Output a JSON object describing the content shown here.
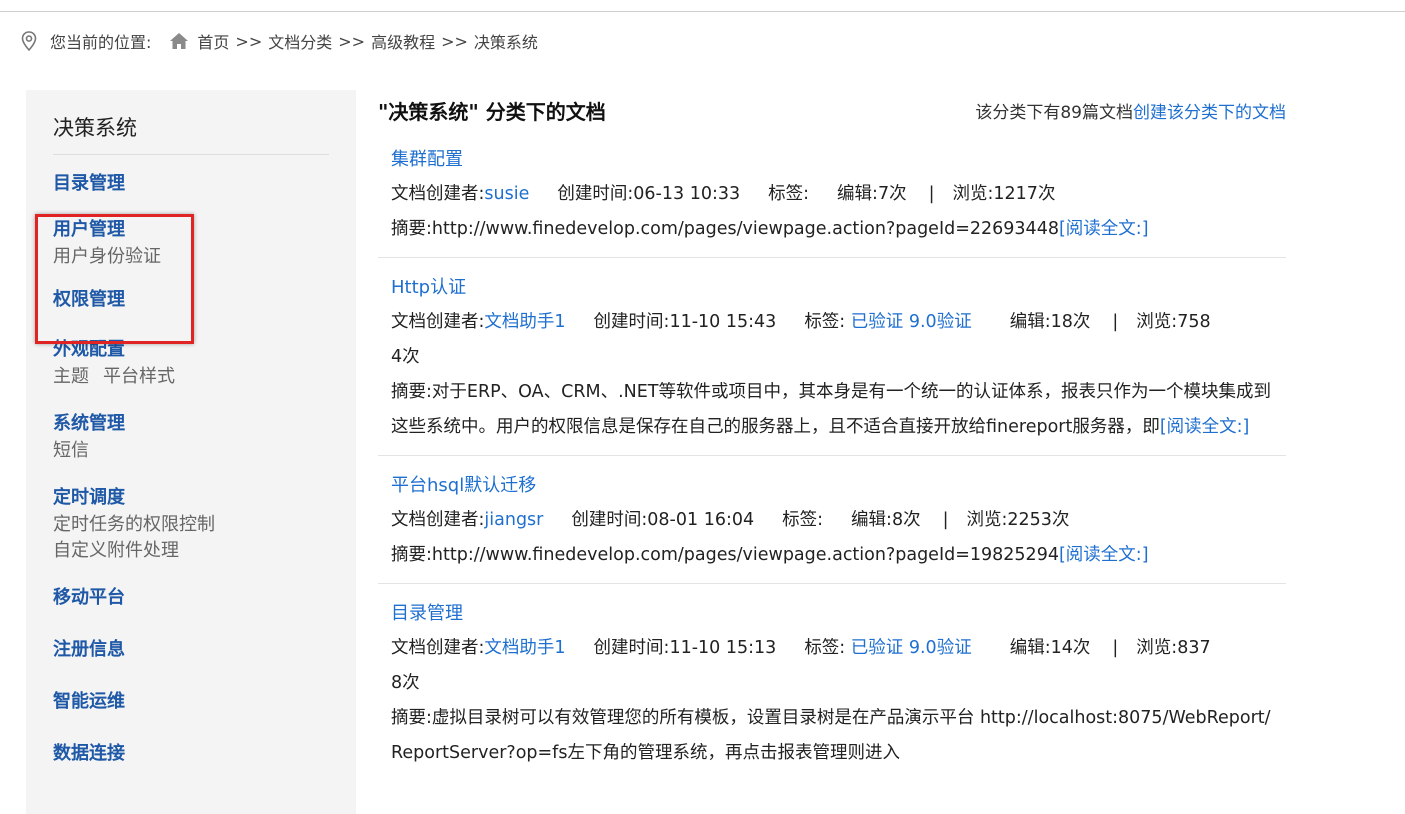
{
  "breadcrumb": {
    "prefix": "您当前的位置:",
    "home": "首页",
    "sep": ">>",
    "items": [
      "文档分类",
      "高级教程",
      "决策系统"
    ]
  },
  "sidebar": {
    "title": "决策系统",
    "groups": [
      {
        "head": "目录管理",
        "subs": []
      },
      {
        "head": "用户管理",
        "subs": [
          "用户身份验证"
        ]
      },
      {
        "head": "权限管理",
        "subs": []
      },
      {
        "head": "外观配置",
        "subs": [
          "主题",
          "平台样式"
        ]
      },
      {
        "head": "系统管理",
        "subs": [
          "短信"
        ]
      },
      {
        "head": "定时调度",
        "subs": [
          "定时任务的权限控制",
          "自定义附件处理"
        ]
      },
      {
        "head": "移动平台",
        "subs": []
      },
      {
        "head": "注册信息",
        "subs": []
      },
      {
        "head": "智能运维",
        "subs": []
      },
      {
        "head": "数据连接",
        "subs": []
      }
    ]
  },
  "main": {
    "title": "\"决策系统\" 分类下的文档",
    "count_text": "该分类下有89篇文档",
    "create_link": "创建该分类下的文档",
    "labels": {
      "creator": "文档创建者:",
      "created": "创建时间:",
      "tags": "标签:",
      "edit": "编辑:",
      "divider": "|",
      "view": "浏览:",
      "summary": "摘要:",
      "read_more": "[阅读全文:]"
    },
    "docs": [
      {
        "title": "集群配置",
        "creator": "susie",
        "created": "06-13 10:33",
        "tags": "",
        "edit": "7次",
        "view": "1217次",
        "summary": "http://www.finedevelop.com/pages/viewpage.action?pageId=22693448"
      },
      {
        "title": "Http认证",
        "creator": "文档助手1",
        "created": "11-10 15:43",
        "tags": "已验证 9.0验证",
        "edit": "18次",
        "view": "7584次",
        "summary": "对于ERP、OA、CRM、.NET等软件或项目中，其本身是有一个统一的认证体系，报表只作为一个模块集成到这些系统中。用户的权限信息是保存在自己的服务器上，且不适合直接开放给finereport服务器，即"
      },
      {
        "title": "平台hsql默认迁移",
        "creator": "jiangsr",
        "created": "08-01 16:04",
        "tags": "",
        "edit": "8次",
        "view": "2253次",
        "summary": "http://www.finedevelop.com/pages/viewpage.action?pageId=19825294"
      },
      {
        "title": "目录管理",
        "creator": "文档助手1",
        "created": "11-10 15:13",
        "tags": "已验证 9.0验证",
        "edit": "14次",
        "view": "8378次",
        "summary": "虚拟目录树可以有效管理您的所有模板，设置目录树是在产品演示平台 http://localhost:8075/WebReport/ReportServer?op=fs左下角的管理系统，再点击报表管理则进入"
      }
    ]
  },
  "colors": {
    "link": "#1e6fd0",
    "sidebar_head": "#1e58a6",
    "sidebar_bg": "#f4f4f4",
    "highlight": "#e02424"
  }
}
